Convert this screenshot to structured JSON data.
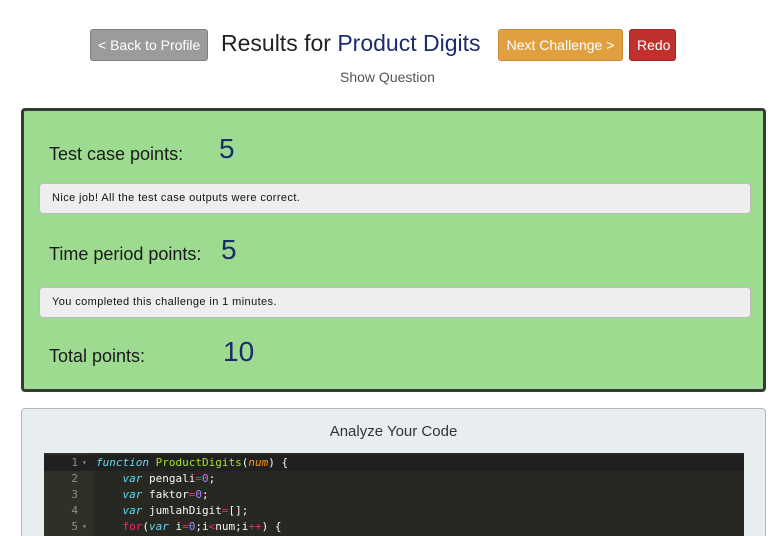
{
  "header": {
    "back_label": "< Back to Profile",
    "title_prefix": "Results for ",
    "challenge_name": "Product Digits",
    "next_label": "Next Challenge >",
    "redo_label": "Redo"
  },
  "show_question_label": "Show Question",
  "results": {
    "test_case_label": "Test case points:",
    "test_case_value": "5",
    "test_case_message": "Nice job! All the test case outputs were correct.",
    "time_label": "Time period points:",
    "time_value": "5",
    "time_message": "You completed this challenge in 1 minutes.",
    "total_label": "Total points:",
    "total_value": "10"
  },
  "analyze": {
    "title": "Analyze Your Code",
    "lines": [
      {
        "num": "1",
        "fold": true
      },
      {
        "num": "2",
        "fold": false
      },
      {
        "num": "3",
        "fold": false
      },
      {
        "num": "4",
        "fold": false
      },
      {
        "num": "5",
        "fold": true
      }
    ],
    "code": {
      "l1_kw": "function",
      "l1_fn": "ProductDigits",
      "l1_param": "num",
      "l2_kw": "var",
      "l2_name": "pengali",
      "l2_num": "0",
      "l3_kw": "var",
      "l3_name": "faktor",
      "l3_num": "0",
      "l4_kw": "var",
      "l4_name": "jumlahDigit",
      "l4_rest": "[];",
      "l5_kw": "for",
      "l5_var": "var",
      "l5_i": "i",
      "l5_num": "0",
      "l5_cond": "i",
      "l5_cmp": "num;i",
      "l5_inc": "++",
      "l5_end": ") {"
    }
  },
  "colors": {
    "results_bg": "#9ddb90",
    "back_button": "#9b9b9b",
    "next_button": "#e0a040",
    "redo_button": "#c0312e",
    "editor_bg": "#272822",
    "value_color": "#1b2b6b"
  }
}
